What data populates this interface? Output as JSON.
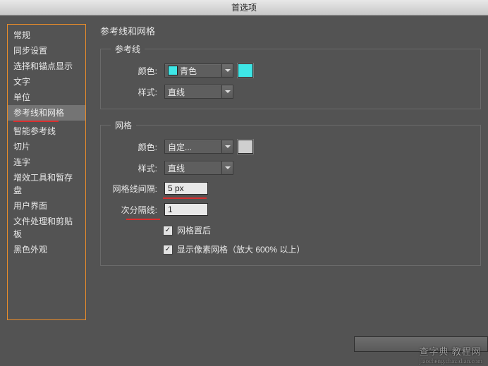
{
  "window": {
    "title": "首选项"
  },
  "sidebar": {
    "items": [
      {
        "label": "常规"
      },
      {
        "label": "同步设置"
      },
      {
        "label": "选择和锚点显示"
      },
      {
        "label": "文字"
      },
      {
        "label": "单位"
      },
      {
        "label": "参考线和网格"
      },
      {
        "label": "智能参考线"
      },
      {
        "label": "切片"
      },
      {
        "label": "连字"
      },
      {
        "label": "增效工具和暂存盘"
      },
      {
        "label": "用户界面"
      },
      {
        "label": "文件处理和剪贴板"
      },
      {
        "label": "黑色外观"
      }
    ],
    "selected_index": 5
  },
  "main": {
    "heading": "参考线和网格",
    "guides": {
      "legend": "参考线",
      "color_label": "颜色:",
      "color_value": "青色",
      "color_hex": "#3ee6e6",
      "style_label": "样式:",
      "style_value": "直线"
    },
    "grid": {
      "legend": "网格",
      "color_label": "颜色:",
      "color_value": "自定...",
      "color_hex": "#cfcfcf",
      "style_label": "样式:",
      "style_value": "直线",
      "spacing_label": "网格线间隔:",
      "spacing_value": "5 px",
      "subdiv_label": "次分隔线:",
      "subdiv_value": "1",
      "cb_grid_back_label": "网格置后",
      "cb_pixel_grid_label": "显示像素网格（放大 600% 以上）"
    }
  },
  "watermark": {
    "text": "查字典 教程网",
    "url": "jiaocheng.chazidian.com"
  }
}
